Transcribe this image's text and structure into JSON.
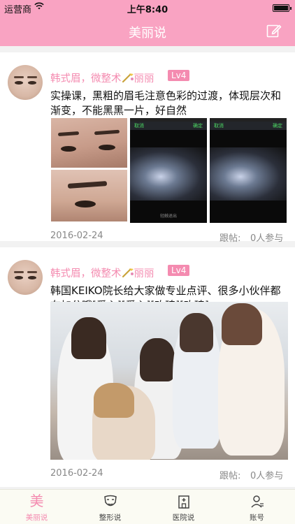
{
  "status_bar": {
    "carrier": "运营商",
    "time": "上午8:40"
  },
  "nav": {
    "title": "美丽说",
    "edit_icon": "edit-icon"
  },
  "posts": [
    {
      "author": "韩式眉，微整术",
      "author_suffix": "丽丽",
      "level": "Lv4",
      "text": "实操课，黑粗的眉毛注意色彩的过渡，体现层次和渐变，不能黑黑一片，好自然",
      "images": [
        {
          "phone_left": "取消",
          "phone_right": "确定",
          "caption": "轻触退出"
        },
        {
          "phone_left": "取消",
          "phone_right": "确定",
          "caption": ""
        }
      ],
      "date": "2016-02-24",
      "follow_label": "跟帖:",
      "count_label": "0人参与"
    },
    {
      "author": "韩式眉，微整术",
      "author_suffix": "丽丽",
      "level": "Lv4",
      "text": "韩国KEIKO院长给大家做专业点评、很多小伙伴都在加分哦[爱心][爱心][玫瑰][玫瑰]",
      "date": "2016-02-24",
      "follow_label": "跟帖:",
      "count_label": "0人参与"
    }
  ],
  "tabs": [
    {
      "label": "美丽说",
      "glyph": "美",
      "icon": "mei-icon",
      "active": true
    },
    {
      "label": "整形说",
      "icon": "mask-icon",
      "active": false
    },
    {
      "label": "医院说",
      "icon": "hospital-icon",
      "active": false
    },
    {
      "label": "账号",
      "icon": "account-icon",
      "active": false
    }
  ],
  "colors": {
    "brand_pink": "#f9a3c2",
    "accent_pink": "#f48bb0",
    "tabbar_bg": "#fbfbf3"
  }
}
